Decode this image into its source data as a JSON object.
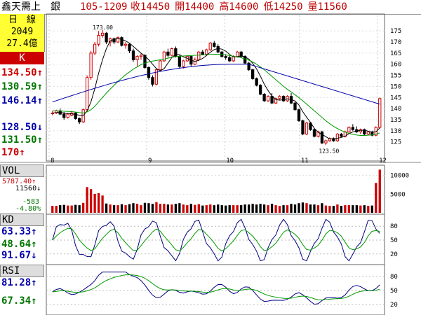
{
  "header": {
    "stock": "鑫天需上　銀",
    "datecode": "105-1209",
    "close": "收14450",
    "open": "開14400",
    "high": "高14600",
    "low": "低14250",
    "volume": "量11560"
  },
  "sidebar": {
    "period": "日　線",
    "code": "2049",
    "amount": "27.4億",
    "k_label": "K",
    "ma_values": [
      "134.50↑",
      "130.59↑",
      "146.14↑"
    ],
    "price_values": [
      "128.50↓",
      "131.50↑",
      "170↑"
    ],
    "vol_label": "VOL",
    "vol_values": [
      "5787.40↑",
      "11560↓"
    ],
    "vol_change": [
      "-583",
      "-4.80%"
    ],
    "kd_label": "KD",
    "kd_values": [
      "63.33↑",
      "48.64↑",
      "91.67↓"
    ],
    "rsi_label": "RSI",
    "rsi_values": [
      "81.28↑",
      "67.34↑"
    ]
  },
  "colors": {
    "up": "#cc0000",
    "down": "#000000",
    "ma5": "#000000",
    "ma20": "#009900",
    "ma60": "#0000aa",
    "kd_k": "#000080",
    "kd_d": "#009900",
    "label_red": "#cc0000",
    "label_green": "#007700",
    "label_blue": "#0000aa"
  },
  "chart_data": [
    {
      "type": "candlestick",
      "ylim": [
        117,
        182
      ],
      "yticks": [
        125,
        130,
        135,
        140,
        145,
        150,
        155,
        160,
        165,
        170,
        175
      ],
      "x_labels": [
        "8",
        "9",
        "10",
        "11",
        "12"
      ],
      "annotations": [
        "173.00",
        "123.50"
      ],
      "ohlc": [
        [
          138,
          139,
          137,
          138
        ],
        [
          138,
          139.5,
          137.5,
          139
        ],
        [
          139,
          140,
          137,
          137.5
        ],
        [
          137.5,
          138.5,
          135,
          136
        ],
        [
          136,
          138,
          135.5,
          137.5
        ],
        [
          137,
          139,
          136.5,
          138
        ],
        [
          138,
          138.5,
          135,
          135.5
        ],
        [
          135.5,
          136,
          133,
          134
        ],
        [
          134,
          140,
          133.5,
          139.5
        ],
        [
          139.5,
          155,
          139,
          154
        ],
        [
          154,
          166,
          153,
          165
        ],
        [
          165,
          170,
          164,
          169
        ],
        [
          169,
          175,
          168,
          173
        ],
        [
          173,
          175.5,
          172,
          174
        ],
        [
          174,
          174.5,
          169,
          170
        ],
        [
          170,
          172,
          168,
          171.5
        ],
        [
          171.5,
          172,
          169,
          170
        ],
        [
          170,
          172.5,
          169.5,
          172
        ],
        [
          172,
          172.5,
          168,
          168.5
        ],
        [
          168.5,
          170,
          167,
          169
        ],
        [
          169,
          169.5,
          165,
          166
        ],
        [
          166,
          167,
          161,
          162
        ],
        [
          162,
          164,
          159,
          163.5
        ],
        [
          163.5,
          165,
          162,
          164
        ],
        [
          164,
          164.5,
          158,
          158.5
        ],
        [
          158.5,
          159,
          153,
          154
        ],
        [
          154,
          155,
          150,
          151
        ],
        [
          151,
          158,
          150.5,
          157.5
        ],
        [
          157.5,
          162,
          157,
          161.5
        ],
        [
          161.5,
          166,
          161,
          165.5
        ],
        [
          165.5,
          167,
          163,
          164
        ],
        [
          164,
          167.5,
          163.5,
          167
        ],
        [
          167,
          168,
          163,
          163.5
        ],
        [
          163.5,
          164,
          158,
          159
        ],
        [
          159,
          162,
          158,
          161.5
        ],
        [
          161.5,
          164,
          161,
          163.5
        ],
        [
          163.5,
          164,
          159,
          160
        ],
        [
          160,
          163,
          159.5,
          162
        ],
        [
          162,
          166,
          161.5,
          165.5
        ],
        [
          165.5,
          166.5,
          164,
          164.5
        ],
        [
          164.5,
          167,
          164,
          166.5
        ],
        [
          166.5,
          170,
          166,
          169.5
        ],
        [
          169.5,
          170.5,
          167.5,
          168
        ],
        [
          168,
          169,
          165,
          165.5
        ],
        [
          165.5,
          166,
          163,
          163.5
        ],
        [
          163.5,
          164.5,
          162,
          163
        ],
        [
          163,
          164,
          161,
          161.5
        ],
        [
          161.5,
          164,
          161,
          163.5
        ],
        [
          163.5,
          166,
          163,
          165.5
        ],
        [
          165.5,
          166,
          163,
          163.5
        ],
        [
          163.5,
          164,
          160,
          160.5
        ],
        [
          160.5,
          161,
          157,
          157.5
        ],
        [
          157.5,
          158,
          153,
          153.5
        ],
        [
          153.5,
          154,
          150,
          150.5
        ],
        [
          150.5,
          151,
          146,
          146.5
        ],
        [
          146.5,
          147,
          143,
          143.5
        ],
        [
          143.5,
          146,
          143,
          145.5
        ],
        [
          145.5,
          147,
          142,
          142.5
        ],
        [
          142.5,
          145,
          142,
          144.5
        ],
        [
          144.5,
          146,
          144,
          145.5
        ],
        [
          145.5,
          146,
          143,
          143.5
        ],
        [
          143.5,
          146,
          143,
          145.5
        ],
        [
          145.5,
          147,
          142,
          142.5
        ],
        [
          142.5,
          143,
          139,
          139.5
        ],
        [
          139.5,
          140,
          134,
          134.5
        ],
        [
          134.5,
          135,
          128,
          128.5
        ],
        [
          128.5,
          134,
          128,
          133.5
        ],
        [
          133.5,
          134,
          130,
          130.5
        ],
        [
          130.5,
          131,
          127,
          127.5
        ],
        [
          127.5,
          130,
          127,
          129.5
        ],
        [
          129.5,
          130,
          124,
          124.5
        ],
        [
          124.5,
          126,
          123.5,
          125.5
        ],
        [
          125.5,
          127,
          125,
          126.5
        ],
        [
          126.5,
          127,
          125,
          125.5
        ],
        [
          125.5,
          129,
          125,
          128.5
        ],
        [
          128.5,
          129,
          127,
          127.5
        ],
        [
          127.5,
          130,
          127,
          129.5
        ],
        [
          129.5,
          132,
          129,
          131.5
        ],
        [
          131.5,
          133,
          130,
          130.5
        ],
        [
          130.5,
          132,
          129,
          129.5
        ],
        [
          129.5,
          131,
          128.5,
          130.5
        ],
        [
          130.5,
          131,
          128,
          128.5
        ],
        [
          128.5,
          130,
          128,
          129.5
        ],
        [
          129.5,
          130,
          127.5,
          128
        ],
        [
          128,
          132,
          127.5,
          131.5
        ],
        [
          131.5,
          145,
          131,
          144.5
        ]
      ],
      "ma5": [
        138,
        138.2,
        138.3,
        138,
        137.8,
        137.6,
        137.4,
        137,
        136.8,
        139,
        143,
        149,
        156,
        162,
        167,
        170.5,
        171.2,
        171.6,
        171.2,
        170.5,
        169.5,
        168,
        166.5,
        165,
        163.7,
        162,
        160,
        158,
        157,
        158,
        160.5,
        163,
        164.5,
        164.3,
        163.3,
        162.7,
        161.8,
        161.2,
        161.8,
        162.6,
        163.9,
        165.4,
        166.6,
        167.1,
        166.8,
        165.9,
        164.4,
        163.3,
        163.3,
        163.8,
        163.3,
        162.3,
        160.4,
        157.9,
        154.6,
        151,
        148.1,
        145.7,
        144.1,
        143.8,
        144,
        144.4,
        144.1,
        143.4,
        141.6,
        138.6,
        136.1,
        133.8,
        131.1,
        129.3,
        128.4,
        127.3,
        126.3,
        126.4,
        126.6,
        127,
        127.5,
        128.7,
        129.5,
        129.9,
        130.2,
        130.3,
        129.8,
        129.4,
        129.5,
        131.3
      ],
      "ma20": [
        139,
        139,
        138.9,
        138.8,
        138.7,
        138.6,
        138.4,
        138.2,
        138,
        138.5,
        139.5,
        141,
        143,
        145,
        147,
        148.8,
        150.5,
        152.2,
        153.8,
        155.2,
        156.5,
        157.8,
        158.8,
        159.8,
        160.5,
        161,
        161.4,
        161.7,
        162,
        162.3,
        162.7,
        163.1,
        163.4,
        163.6,
        163.7,
        163.8,
        163.9,
        164,
        164.1,
        164.2,
        164.3,
        164.4,
        164.5,
        164.5,
        164.4,
        164.2,
        163.9,
        163.6,
        163.3,
        162.9,
        162.4,
        161.8,
        161,
        160,
        158.8,
        157.5,
        156,
        154.5,
        153,
        151.5,
        150,
        148.7,
        147.5,
        146.2,
        144.9,
        143.5,
        142,
        140.5,
        139,
        137.5,
        136,
        134.5,
        133.2,
        132,
        131,
        130.1,
        129.4,
        128.8,
        128.4,
        128.1,
        127.9,
        127.9,
        128,
        128.2,
        128.5,
        129
      ]
    },
    {
      "type": "bar",
      "name": "VOL",
      "yticks": [
        10000,
        5000
      ],
      "ylim": [
        0,
        12000
      ]
    },
    {
      "type": "line",
      "name": "KD",
      "yticks": [
        80,
        50,
        20
      ],
      "ylim": [
        0,
        100
      ]
    },
    {
      "type": "line",
      "name": "RSI",
      "yticks": [
        80,
        50,
        20
      ],
      "ylim": [
        0,
        100
      ]
    }
  ]
}
